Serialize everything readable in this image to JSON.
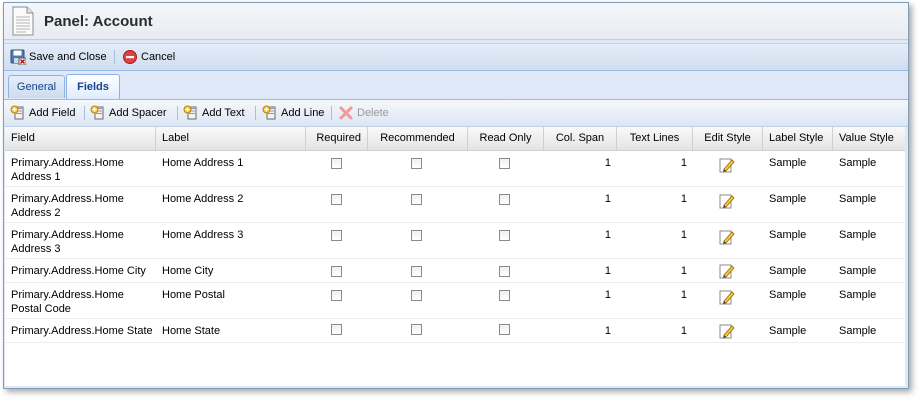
{
  "panel": {
    "title": "Panel: Account"
  },
  "toolbar": {
    "save_close": "Save and Close",
    "cancel": "Cancel"
  },
  "tabs": [
    {
      "label": "General"
    },
    {
      "label": "Fields"
    }
  ],
  "active_tab": "Fields",
  "field_toolbar": {
    "add_field": "Add Field",
    "add_spacer": "Add Spacer",
    "add_text": "Add Text",
    "add_line": "Add Line",
    "delete": "Delete"
  },
  "columns": [
    "Field",
    "Label",
    "Required",
    "Recommended",
    "Read Only",
    "Col. Span",
    "Text Lines",
    "Edit Style",
    "Label Style",
    "Value Style"
  ],
  "rows": [
    {
      "field": "Primary.Address.Home Address 1",
      "label": "Home Address 1",
      "required": false,
      "recommended": false,
      "read_only": false,
      "col_span": "1",
      "text_lines": "1",
      "label_style": "Sample",
      "value_style": "Sample"
    },
    {
      "field": "Primary.Address.Home Address 2",
      "label": "Home Address 2",
      "required": false,
      "recommended": false,
      "read_only": false,
      "col_span": "1",
      "text_lines": "1",
      "label_style": "Sample",
      "value_style": "Sample"
    },
    {
      "field": "Primary.Address.Home Address 3",
      "label": "Home Address 3",
      "required": false,
      "recommended": false,
      "read_only": false,
      "col_span": "1",
      "text_lines": "1",
      "label_style": "Sample",
      "value_style": "Sample"
    },
    {
      "field": "Primary.Address.Home City",
      "label": "Home City",
      "required": false,
      "recommended": false,
      "read_only": false,
      "col_span": "1",
      "text_lines": "1",
      "label_style": "Sample",
      "value_style": "Sample"
    },
    {
      "field": "Primary.Address.Home Postal Code",
      "label": "Home Postal",
      "required": false,
      "recommended": false,
      "read_only": false,
      "col_span": "1",
      "text_lines": "1",
      "label_style": "Sample",
      "value_style": "Sample"
    },
    {
      "field": "Primary.Address.Home State",
      "label": "Home State",
      "required": false,
      "recommended": false,
      "read_only": false,
      "col_span": "1",
      "text_lines": "1",
      "label_style": "Sample",
      "value_style": "Sample"
    }
  ],
  "icons": {
    "title": "document-icon",
    "save": "save-close-icon",
    "cancel": "cancel-icon",
    "add": "add-item-icon",
    "delete": "delete-icon",
    "edit": "pencil-icon"
  },
  "colors": {
    "accent": "#15428b",
    "panel_bg": "#dfe8f6",
    "tab_border": "#8db2e3"
  }
}
